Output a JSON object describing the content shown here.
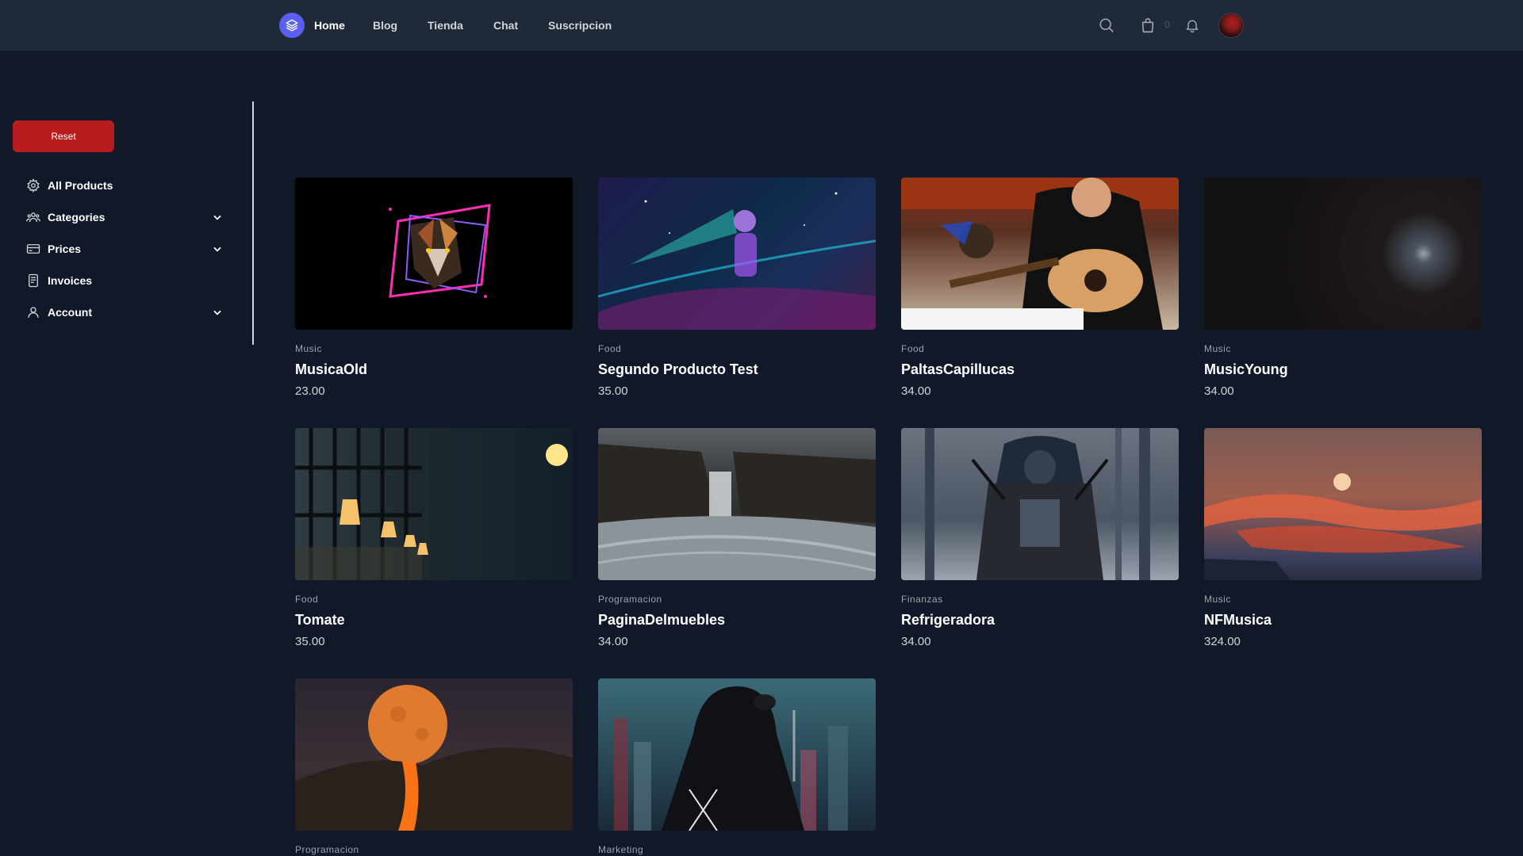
{
  "nav": {
    "links": [
      "Home",
      "Blog",
      "Tienda",
      "Chat",
      "Suscripcion"
    ],
    "cart_count": "0",
    "icons": [
      "search-icon",
      "shopping-bag-icon",
      "bell-icon",
      "avatar"
    ]
  },
  "sidebar": {
    "reset_label": "Reset",
    "items": [
      {
        "label": "All Products",
        "icon": "gear-icon",
        "expandable": false
      },
      {
        "label": "Categories",
        "icon": "users-icon",
        "expandable": true
      },
      {
        "label": "Prices",
        "icon": "credit-card-icon",
        "expandable": true
      },
      {
        "label": "Invoices",
        "icon": "receipt-icon",
        "expandable": false
      },
      {
        "label": "Account",
        "icon": "user-icon",
        "expandable": true
      }
    ]
  },
  "products": [
    {
      "category": "Music",
      "name": "MusicaOld",
      "price": "23.00"
    },
    {
      "category": "Food",
      "name": "Segundo Producto Test",
      "price": "35.00"
    },
    {
      "category": "Food",
      "name": "PaltasCapillucas",
      "price": "34.00"
    },
    {
      "category": "Music",
      "name": "MusicYoung",
      "price": "34.00"
    },
    {
      "category": "Food",
      "name": "Tomate",
      "price": "35.00"
    },
    {
      "category": "Programacion",
      "name": "PaginaDelmuebles",
      "price": "34.00"
    },
    {
      "category": "Finanzas",
      "name": "Refrigeradora",
      "price": "34.00"
    },
    {
      "category": "Music",
      "name": "NFMusica",
      "price": "324.00"
    },
    {
      "category": "Programacion",
      "name": "",
      "price": ""
    },
    {
      "category": "Marketing",
      "name": "",
      "price": ""
    }
  ],
  "colors": {
    "background": "#111827",
    "topnav": "#1f2937",
    "reset_button": "#b91c1c",
    "logo": "#5b5ff0"
  }
}
